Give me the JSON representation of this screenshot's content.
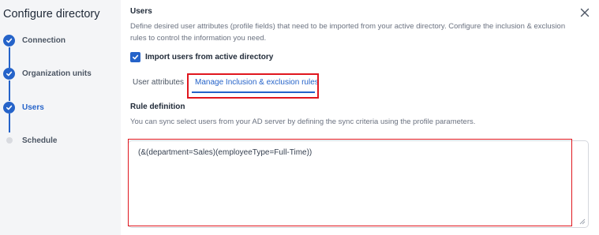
{
  "sidebar": {
    "title": "Configure directory",
    "steps": [
      {
        "label": "Connection",
        "status": "completed"
      },
      {
        "label": "Organization units",
        "status": "completed"
      },
      {
        "label": "Users",
        "status": "active"
      },
      {
        "label": "Schedule",
        "status": "pending"
      }
    ]
  },
  "main": {
    "section_title": "Users",
    "description": "Define desired user attributes (profile fields) that need to be imported from your active directory. Configure the inclusion & exclusion rules to control the information you need.",
    "import_checkbox": {
      "label": "Import users from active directory",
      "checked": true
    },
    "tabs": [
      {
        "label": "User attributes",
        "selected": false
      },
      {
        "label": "Manage Inclusion & exclusion rules",
        "selected": true
      }
    ],
    "rule_definition": {
      "title": "Rule definition",
      "description": "You can sync select users from your AD server by defining the sync criteria using the profile parameters.",
      "value": "(&(department=Sales)(employeeType=Full-Time))"
    }
  },
  "colors": {
    "accent": "#2563c9",
    "highlight": "#e0161e",
    "sidebar_bg": "#f4f5f7"
  },
  "icons": {
    "close": "close-icon",
    "step_done": "check-icon",
    "checkbox": "check-icon"
  }
}
